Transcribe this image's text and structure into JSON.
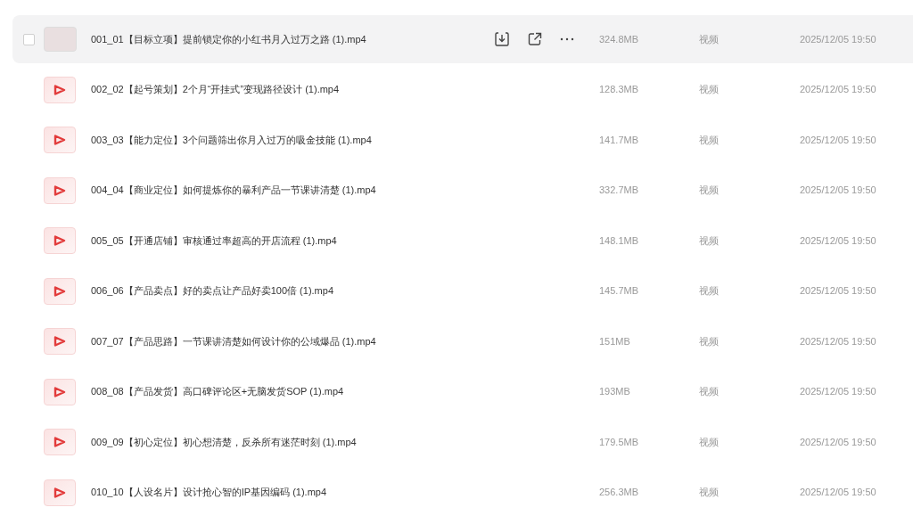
{
  "files": [
    {
      "kind": "photo",
      "hovered": true,
      "name": "001_01【目标立项】提前锁定你的小红书月入过万之路 (1).mp4",
      "size": "324.8MB",
      "type": "视频",
      "modified": "2025/12/05 19:50"
    },
    {
      "kind": "video",
      "hovered": false,
      "name": "002_02【起号策划】2个月“开挂式”变现路径设计 (1).mp4",
      "size": "128.3MB",
      "type": "视频",
      "modified": "2025/12/05 19:50"
    },
    {
      "kind": "video",
      "hovered": false,
      "name": "003_03【能力定位】3个问题筛出你月入过万的吸金技能 (1).mp4",
      "size": "141.7MB",
      "type": "视频",
      "modified": "2025/12/05 19:50"
    },
    {
      "kind": "video",
      "hovered": false,
      "name": "004_04【商业定位】如何提炼你的暴利产品一节课讲清楚 (1).mp4",
      "size": "332.7MB",
      "type": "视频",
      "modified": "2025/12/05 19:50"
    },
    {
      "kind": "video",
      "hovered": false,
      "name": "005_05【开通店铺】审核通过率超高的开店流程 (1).mp4",
      "size": "148.1MB",
      "type": "视频",
      "modified": "2025/12/05 19:50"
    },
    {
      "kind": "video",
      "hovered": false,
      "name": "006_06【产品卖点】好的卖点让产品好卖100倍 (1).mp4",
      "size": "145.7MB",
      "type": "视频",
      "modified": "2025/12/05 19:50"
    },
    {
      "kind": "video",
      "hovered": false,
      "name": "007_07【产品思路】一节课讲清楚如何设计你的公域爆品 (1).mp4",
      "size": "151MB",
      "type": "视频",
      "modified": "2025/12/05 19:50"
    },
    {
      "kind": "video",
      "hovered": false,
      "name": "008_08【产品发货】高口碑评论区+无脑发货SOP (1).mp4",
      "size": "193MB",
      "type": "视频",
      "modified": "2025/12/05 19:50"
    },
    {
      "kind": "video",
      "hovered": false,
      "name": "009_09【初心定位】初心想清楚，反杀所有迷茫时刻 (1).mp4",
      "size": "179.5MB",
      "type": "视频",
      "modified": "2025/12/05 19:50"
    },
    {
      "kind": "video",
      "hovered": false,
      "name": "010_10【人设名片】设计抢心智的IP基因编码 (1).mp4",
      "size": "256.3MB",
      "type": "视频",
      "modified": "2025/12/05 19:50"
    }
  ]
}
